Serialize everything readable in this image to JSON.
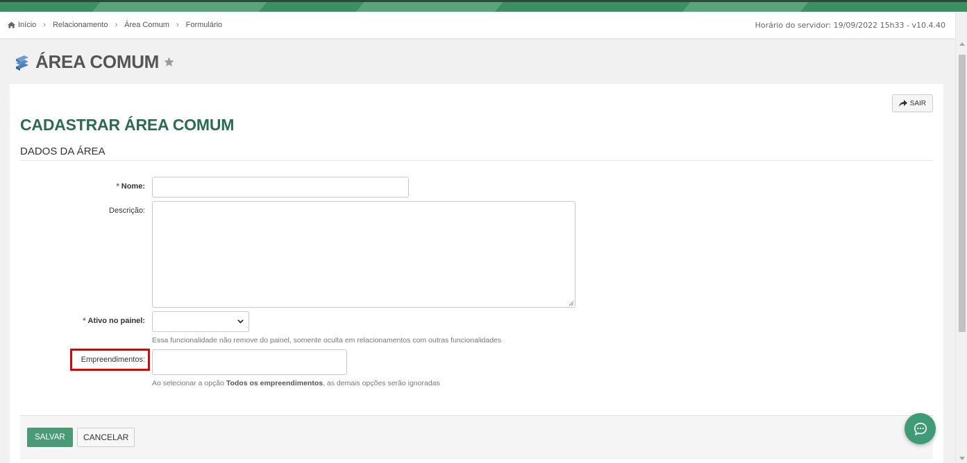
{
  "breadcrumb": {
    "items": [
      "Início",
      "Relacionamento",
      "Área Comum",
      "Formulário"
    ],
    "server_time": "Horário do servidor: 19/09/2022 15h33 - v10.4.40"
  },
  "header": {
    "title": "ÁREA COMUM"
  },
  "card": {
    "exit_label": "SAIR",
    "form_title": "CADASTRAR ÁREA COMUM",
    "section_title": "DADOS DA ÁREA"
  },
  "form": {
    "required_mark": "*",
    "nome_label": "Nome:",
    "nome_value": "",
    "descricao_label": "Descrição:",
    "descricao_value": "",
    "ativo_label": "Ativo no painel:",
    "ativo_value": "",
    "ativo_hint": "Essa funcionalidade não remove do painel, somente oculta em relacionamentos com outras funcionalidades",
    "empreendimentos_label": "Empreendimentos:",
    "empreendimentos_value": "",
    "empreendimentos_hint_prefix": "Ao selecionar a opção ",
    "empreendimentos_hint_bold": "Todos os empreendimentos",
    "empreendimentos_hint_suffix": ", as demais opções serão ignoradas"
  },
  "actions": {
    "save_label": "SALVAR",
    "cancel_label": "CANCELAR"
  },
  "icons": {
    "home": "home-icon",
    "module": "area-comum-module-icon",
    "favorite": "star-icon",
    "exit": "share-arrow-icon",
    "chat": "chat-bubble-icon"
  },
  "colors": {
    "brand_green": "#3c8f63",
    "title_green": "#2d6a52",
    "save_button": "#4a9a77",
    "highlight": "#e00000",
    "required": "#b94a48"
  }
}
